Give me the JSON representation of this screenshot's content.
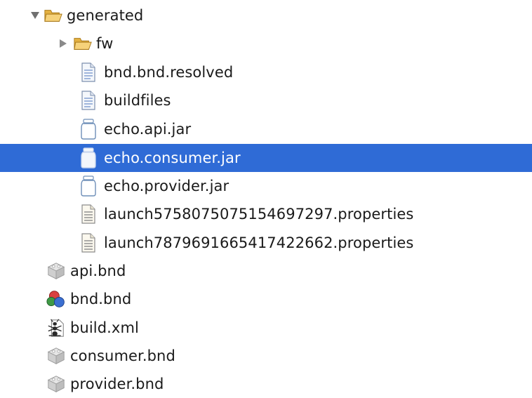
{
  "tree": {
    "generated": {
      "label": "generated",
      "icon": "folder-open-icon",
      "expanded": true
    },
    "fw": {
      "label": "fw",
      "icon": "folder-open-icon",
      "expanded": false
    },
    "bnd_bnd_resolved": {
      "label": "bnd.bnd.resolved",
      "icon": "text-file-icon"
    },
    "buildfiles": {
      "label": "buildfiles",
      "icon": "text-file-icon"
    },
    "echo_api_jar": {
      "label": "echo.api.jar",
      "icon": "jar-icon"
    },
    "echo_consumer_jar": {
      "label": "echo.consumer.jar",
      "icon": "jar-icon",
      "selected": true
    },
    "echo_provider_jar": {
      "label": "echo.provider.jar",
      "icon": "jar-icon"
    },
    "launch1": {
      "label": "launch5758075075154697297.properties",
      "icon": "properties-file-icon"
    },
    "launch2": {
      "label": "launch7879691665417422662.properties",
      "icon": "properties-file-icon"
    },
    "api_bnd": {
      "label": "api.bnd",
      "icon": "bundle-icon"
    },
    "bnd_bnd": {
      "label": "bnd.bnd",
      "icon": "bnd-project-icon"
    },
    "build_xml": {
      "label": "build.xml",
      "icon": "ant-file-icon"
    },
    "consumer_bnd": {
      "label": "consumer.bnd",
      "icon": "bundle-icon"
    },
    "provider_bnd": {
      "label": "provider.bnd",
      "icon": "bundle-icon"
    }
  },
  "colors": {
    "selection": "#2f6bd6",
    "folder": "#f2c14e",
    "text": "#1a1a1a"
  }
}
